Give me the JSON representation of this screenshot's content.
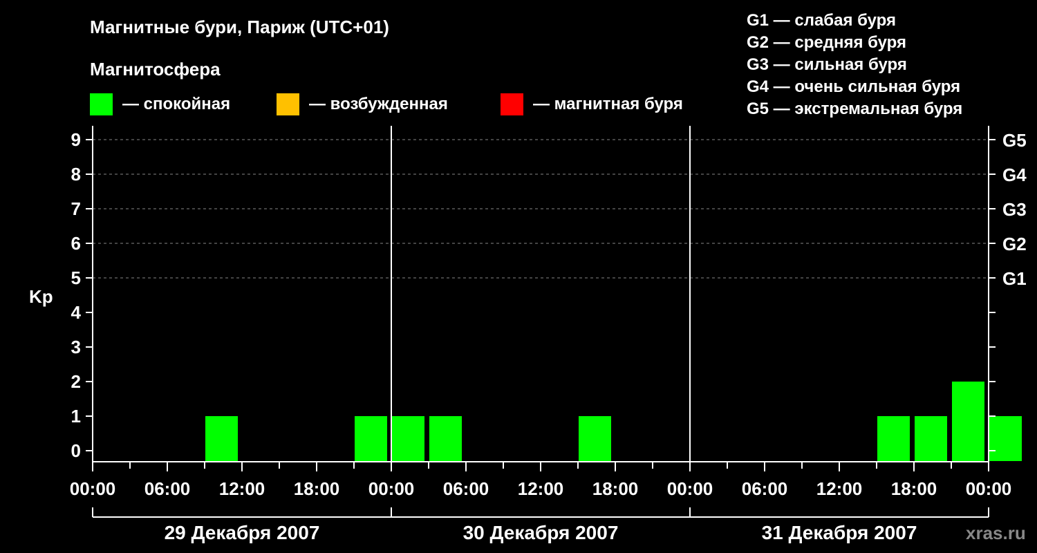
{
  "title": "Магнитные бури, Париж (UTC+01)",
  "legend": {
    "heading": "Магнитосфера",
    "items": [
      {
        "label": "— спокойная",
        "color": "#00ff00"
      },
      {
        "label": "— возбужденная",
        "color": "#ffc000"
      },
      {
        "label": "— магнитная буря",
        "color": "#ff0000"
      }
    ]
  },
  "storm_scale": [
    "G1 — слабая буря",
    "G2 — средняя буря",
    "G3 — сильная буря",
    "G4 — очень сильная буря",
    "G5 — экстремальная буря"
  ],
  "watermark": "xras.ru",
  "chart_data": {
    "type": "bar",
    "ylabel": "Kp",
    "ylim": [
      0,
      9
    ],
    "yticks": [
      "0",
      "1",
      "2",
      "3",
      "4",
      "5",
      "6",
      "7",
      "8",
      "9"
    ],
    "g_ticks": [
      {
        "kp": 5,
        "label": "G1"
      },
      {
        "kp": 6,
        "label": "G2"
      },
      {
        "kp": 7,
        "label": "G3"
      },
      {
        "kp": 8,
        "label": "G4"
      },
      {
        "kp": 9,
        "label": "G5"
      }
    ],
    "grid": "dashed horizontal at Kp 5–9",
    "days": [
      "29 Декабря 2007",
      "30 Декабря 2007",
      "31 Декабря 2007"
    ],
    "xtick_labels": [
      "00:00",
      "06:00",
      "12:00",
      "18:00",
      "00:00",
      "06:00",
      "12:00",
      "18:00",
      "00:00",
      "06:00",
      "12:00",
      "18:00",
      "00:00"
    ],
    "interval_hours": 3,
    "series": [
      {
        "color": "#00ff00",
        "values": [
          0,
          0,
          0,
          1,
          0,
          0,
          0,
          1,
          1,
          1,
          0,
          0,
          0,
          1,
          0,
          0,
          0,
          0,
          0,
          0,
          0,
          1,
          1,
          2,
          1
        ]
      }
    ]
  }
}
